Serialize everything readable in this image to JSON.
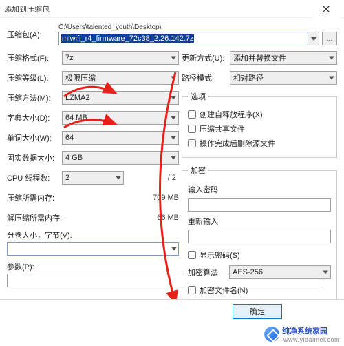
{
  "title": "添加到压缩包",
  "archive": {
    "label": "压缩包(A):",
    "path_prefix": "C:\\Users\\talented_youth\\Desktop\\",
    "filename_selected": "miwifi_r4_firmware_72c38_2.26.142.7z",
    "browse": "..."
  },
  "left": {
    "format": {
      "label": "压缩格式(F):",
      "value": "7z"
    },
    "level": {
      "label": "压缩等级(L):",
      "value": "极限压缩"
    },
    "method": {
      "label": "压缩方法(M):",
      "value": "LZMA2"
    },
    "dict": {
      "label": "字典大小(D):",
      "value": "64 MB"
    },
    "word": {
      "label": "单词大小(W):",
      "value": "64"
    },
    "solid": {
      "label": "固实数据大小:",
      "value": "4 GB"
    },
    "cpu": {
      "label": "CPU 线程数:",
      "value": "2",
      "total": "/ 2"
    },
    "memc": {
      "label": "压缩所需内存:",
      "value": "709 MB"
    },
    "memd": {
      "label": "解压缩所需内存:",
      "value": "66 MB"
    },
    "split": {
      "label": "分卷大小，字节(V):"
    },
    "params": {
      "label": "参数(P):"
    }
  },
  "right": {
    "update": {
      "label": "更新方式(U):",
      "value": "添加并替换文件"
    },
    "pathmode": {
      "label": "路径模式:",
      "value": "相对路径"
    },
    "options": {
      "legend": "选项",
      "sfx": "创建自释放程序(X)",
      "shared": "压缩共享文件",
      "delete": "操作完成后删除源文件"
    },
    "enc": {
      "legend": "加密",
      "pw": "输入密码:",
      "pw2": "重新输入:",
      "show": "显示密码(S)",
      "algo_label": "加密算法:",
      "algo": "AES-256",
      "encnames": "加密文件名(N)"
    }
  },
  "buttons": {
    "ok": "确定"
  },
  "watermark": {
    "brand": "纯净系统家园",
    "url": "www.yidaimei.com"
  }
}
